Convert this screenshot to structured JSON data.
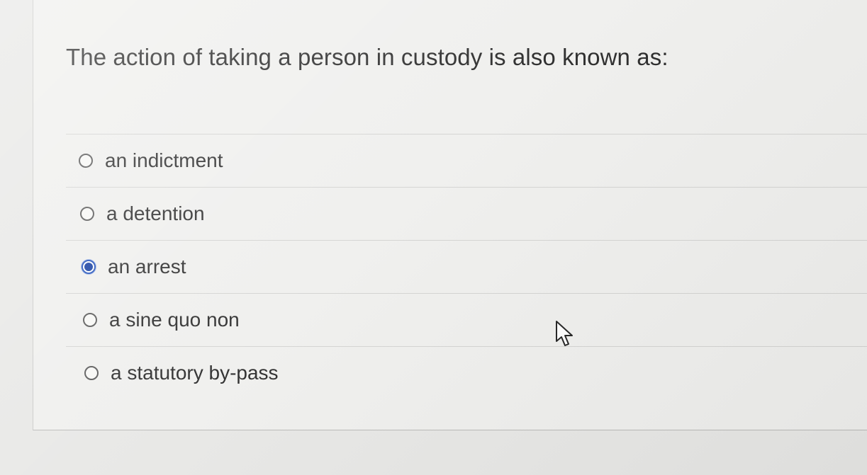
{
  "question": {
    "text": "The action of taking a person in custody is also known as:"
  },
  "answers": [
    {
      "label": "an indictment",
      "selected": false
    },
    {
      "label": "a detention",
      "selected": false
    },
    {
      "label": "an arrest",
      "selected": true
    },
    {
      "label": "a sine quo non",
      "selected": false
    },
    {
      "label": "a statutory by-pass",
      "selected": false
    }
  ],
  "colors": {
    "selected_radio": "#103a9e",
    "background": "#efefed"
  },
  "icons": {
    "cursor": "arrow-pointer-icon"
  }
}
